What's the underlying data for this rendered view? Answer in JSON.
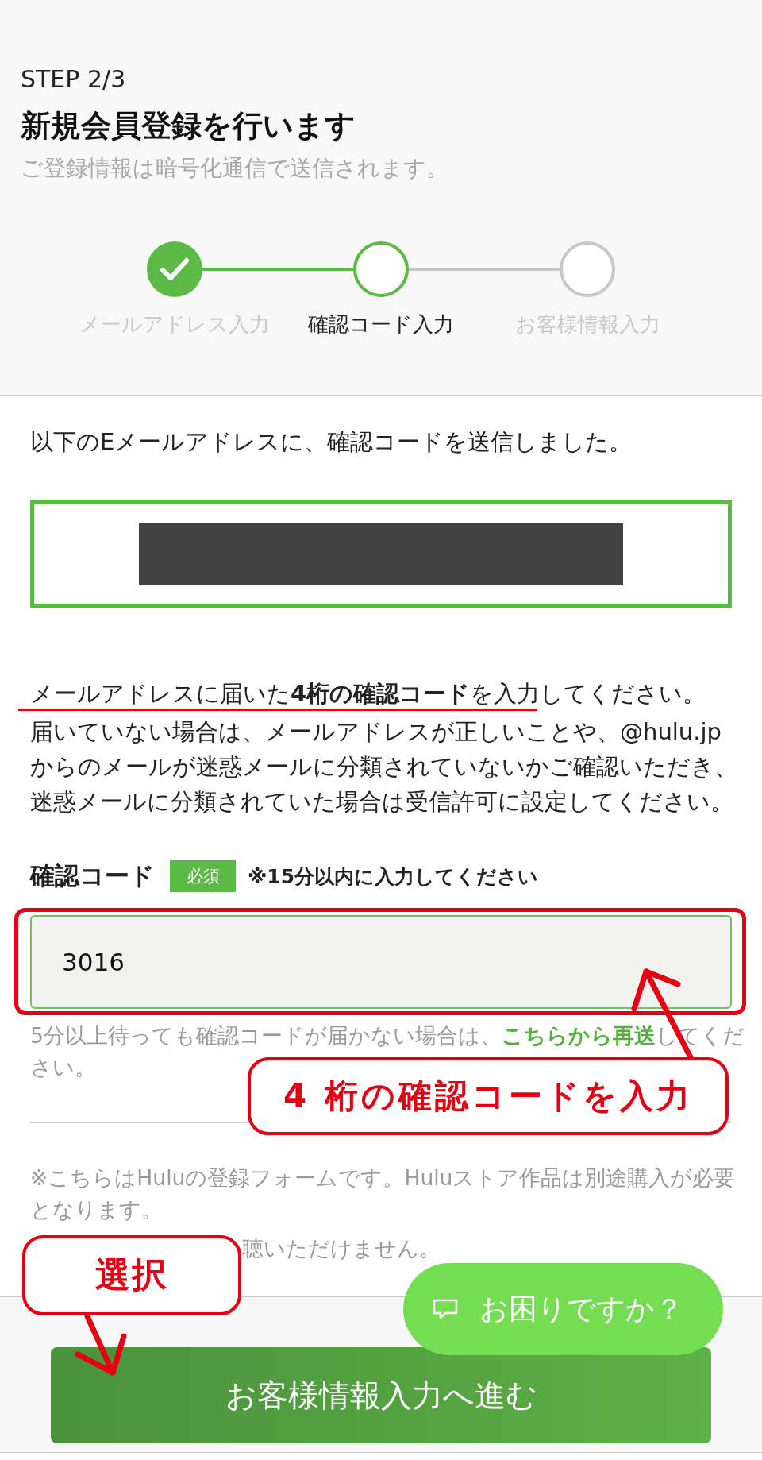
{
  "header": {
    "step": "STEP 2/3",
    "title": "新規会員登録を行います",
    "subtitle": "ご登録情報は暗号化通信で送信されます。"
  },
  "stepper": [
    {
      "label": "メールアドレス入力",
      "completed": true,
      "selected": false
    },
    {
      "label": "確認コード入力",
      "completed": false,
      "selected": true
    },
    {
      "label": "お客様情報入力",
      "completed": false,
      "selected": false
    }
  ],
  "sent_notice": "以下のEメールアドレスに、確認コードを送信しました。",
  "instruction": "メールアドレスに届いた**4桁の確認コード**を入力してください。",
  "instruction_note": "届いていない場合は、メールアドレスが正しいことや、@hulu.jpからのメールが迷惑メールに分類されていないかご確認いただき、迷惑メールに分類されていた場合は受信許可に設定してください。",
  "code_field": {
    "label": "確認コード",
    "required_badge": "必須",
    "hint": "※15分以内に入力してください",
    "value": "3016"
  },
  "resend": {
    "text_before": "5分以上待っても確認コードが届かない場合は、",
    "link": "こちらから再送",
    "text_after": "してください。"
  },
  "footer_notes": [
    "※こちらはHuluの登録フォームです。Huluストア作品は別途購入が必要となります。",
    "聴いただけません。"
  ],
  "help_button": "お困りですか？",
  "submit_button": "お客様情報入力へ進む",
  "annotations": [
    {
      "kind": "underline"
    },
    {
      "kind": "frame"
    },
    {
      "kind": "arrow"
    },
    {
      "kind": "callout",
      "text": "4 桁の確認コードを入力"
    },
    {
      "kind": "arrow"
    },
    {
      "kind": "callout",
      "text": "選択"
    }
  ]
}
